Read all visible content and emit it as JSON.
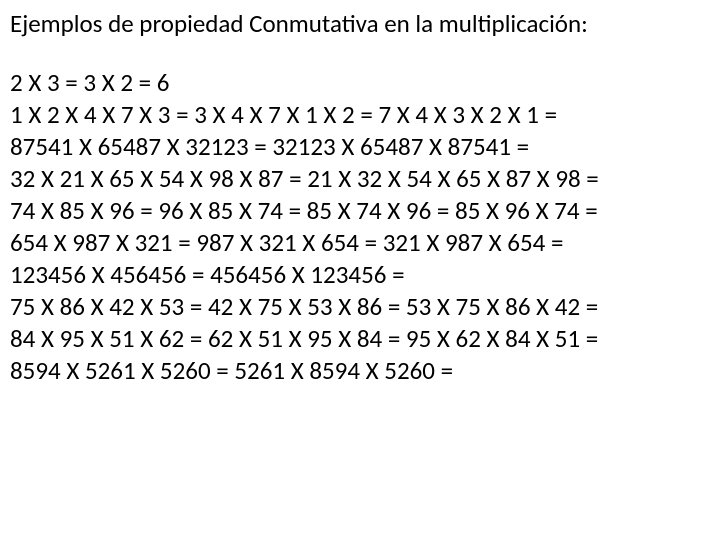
{
  "title": "Ejemplos de propiedad Conmutativa en la multiplicación:",
  "lines": [
    "2 X 3 = 3 X 2 = 6",
    "1 X 2 X 4 X 7 X 3 = 3 X 4 X 7 X 1 X 2 = 7 X 4 X 3 X 2 X 1 =",
    "87541 X 65487 X 32123 = 32123 X 65487 X 87541 =",
    "32 X 21 X 65 X 54 X 98 X 87 = 21 X 32 X 54 X 65 X 87 X 98 =",
    "74 X 85 X 96 = 96 X 85 X 74 = 85 X 74 X 96 = 85 X 96 X 74 =",
    "654 X 987 X 321 = 987 X 321 X 654 = 321 X 987 X 654 =",
    "123456 X 456456 = 456456 X 123456 =",
    "75 X 86 X 42 X 53 = 42 X 75 X 53 X 86 = 53 X 75 X 86 X 42 =",
    "84 X 95 X 51 X 62 = 62 X 51 X 95 X 84 = 95 X 62 X 84 X 51 =",
    "8594 X 5261 X 5260 = 5261 X 8594 X 5260 ="
  ]
}
